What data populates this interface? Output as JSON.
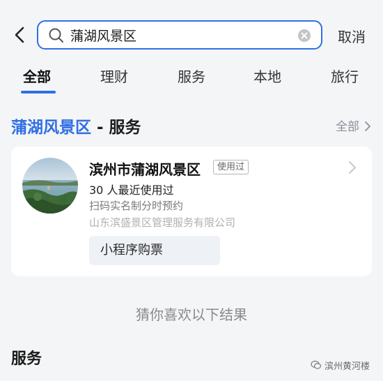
{
  "search": {
    "value": "蒲湖风景区",
    "cancel_label": "取消"
  },
  "tabs": [
    {
      "label": "全部",
      "active": true
    },
    {
      "label": "理财",
      "active": false
    },
    {
      "label": "服务",
      "active": false
    },
    {
      "label": "本地",
      "active": false
    },
    {
      "label": "旅行",
      "active": false
    }
  ],
  "section": {
    "highlight": "蒲湖风景区",
    "suffix": " - 服务",
    "all_label": "全部"
  },
  "card": {
    "title": "滨州市蒲湖风景区",
    "badge": "使用过",
    "usage": "30 人最近使用过",
    "description": "扫码实名制分时预约",
    "provider": "山东滨盛景区管理服务有限公司",
    "button_label": "小程序购票"
  },
  "guess_label": "猜你喜欢以下结果",
  "services_heading": "服务",
  "watermark": "滨州黄河楼",
  "colors": {
    "accent": "#2f6fe4",
    "background": "#f4f5f7"
  }
}
